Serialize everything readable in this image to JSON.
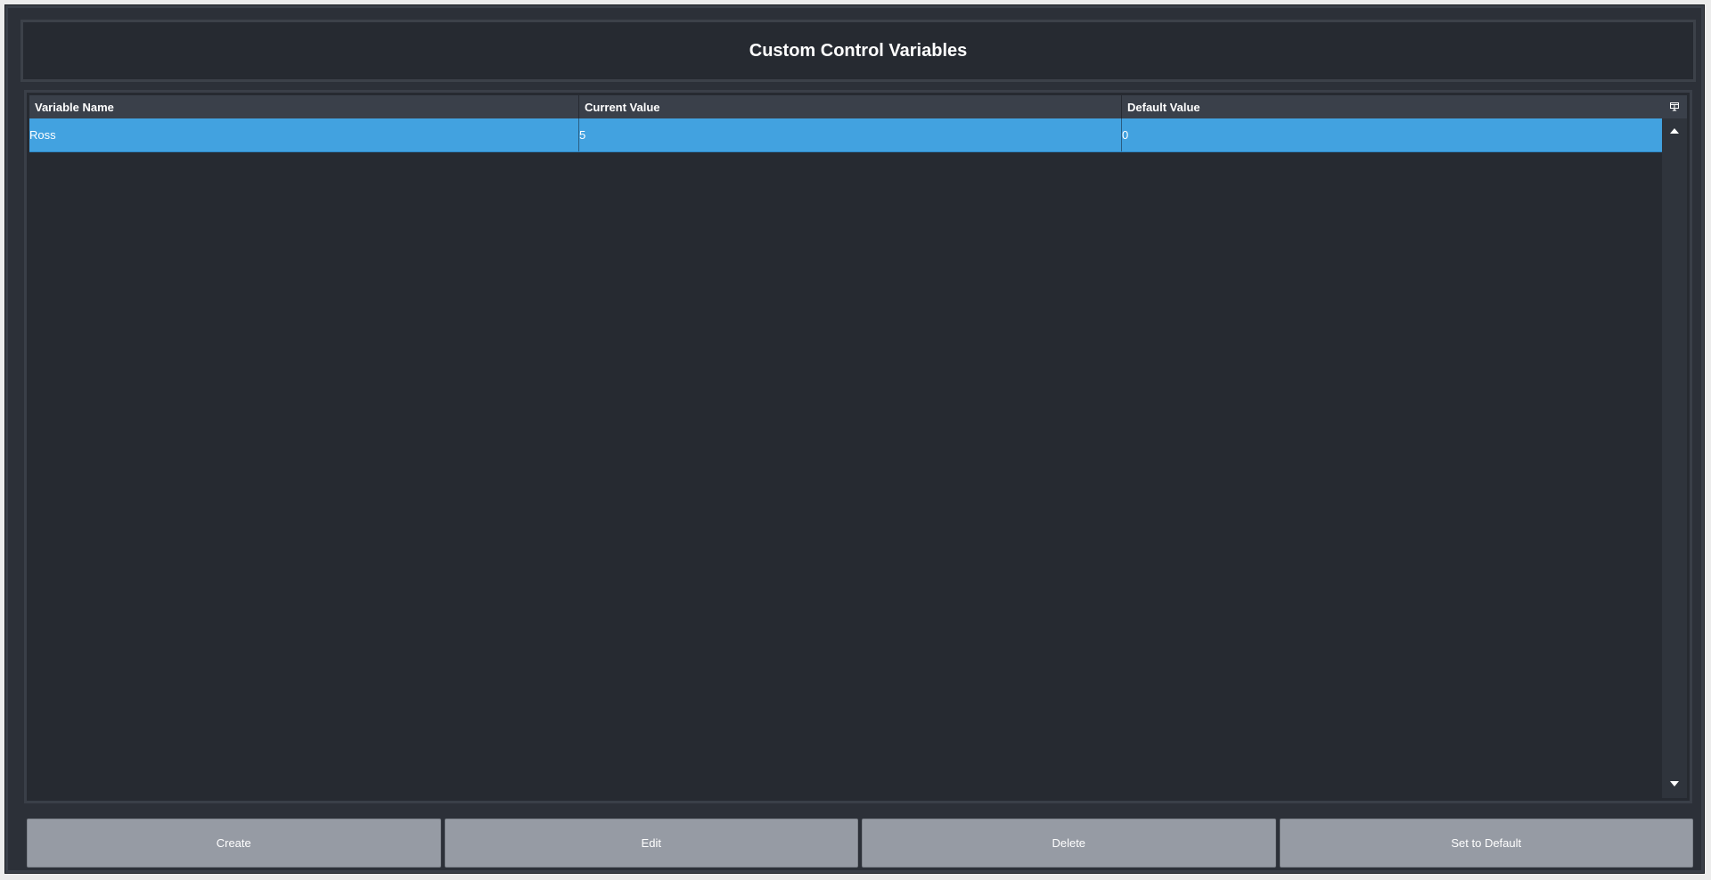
{
  "title": "Custom Control Variables",
  "table": {
    "columns": [
      "Variable Name",
      "Current Value",
      "Default Value"
    ],
    "rows": [
      {
        "name": "Ross",
        "current": "5",
        "default": "0"
      }
    ]
  },
  "buttons": {
    "create": "Create",
    "edit": "Edit",
    "delete": "Delete",
    "set_default": "Set to Default"
  },
  "colors": {
    "selected_row": "#42a2e0",
    "background": "#262a31",
    "button": "#969ba4"
  },
  "icons": {
    "column_picker": "column-chooser-icon",
    "scroll_up": "scroll-up-arrow-icon",
    "scroll_down": "scroll-down-arrow-icon"
  }
}
